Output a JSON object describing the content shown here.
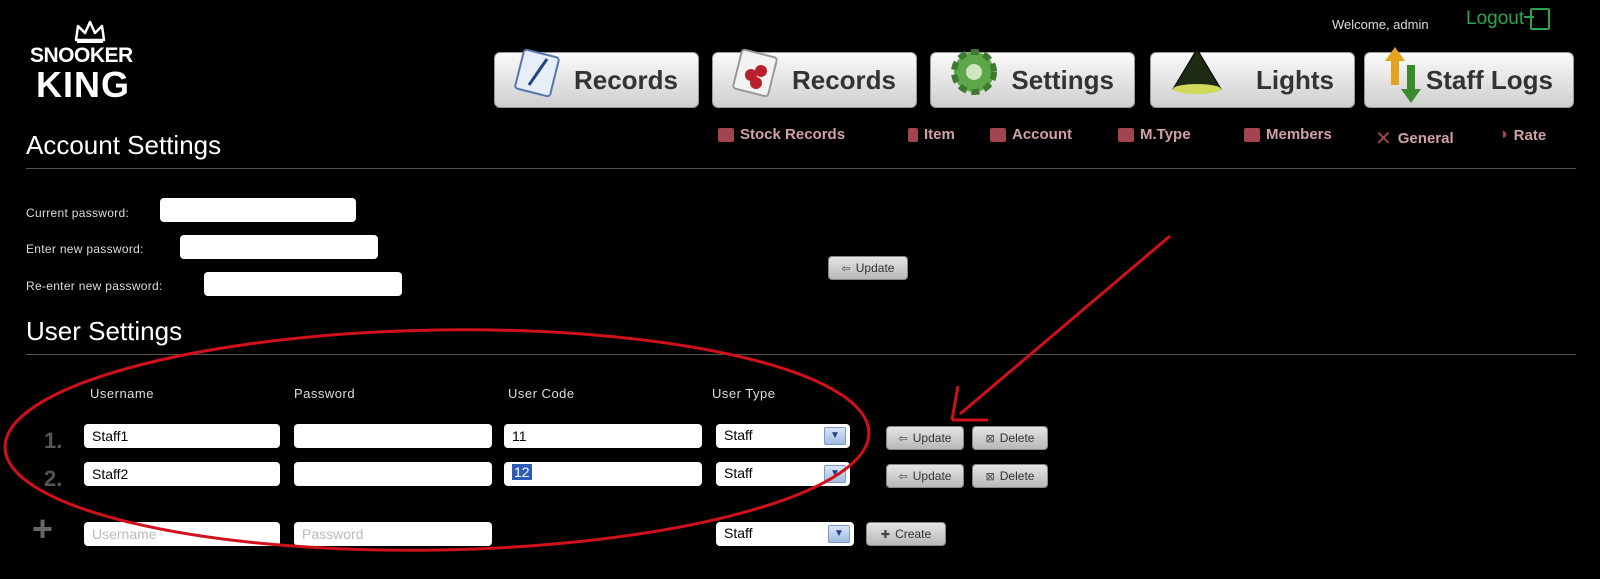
{
  "header": {
    "logo_line1": "SNOOKER",
    "logo_line2": "KING",
    "welcome": "Welcome, admin",
    "logout": "Logout"
  },
  "tabs": [
    {
      "label": "Records",
      "icon": "notepad-icon"
    },
    {
      "label": "Records",
      "icon": "balls-icon"
    },
    {
      "label": "Settings",
      "icon": "gear-icon"
    },
    {
      "label": "Lights",
      "icon": "lamp-icon"
    },
    {
      "label": "Staff Logs",
      "icon": "up-down-arrows-icon"
    }
  ],
  "subnav": [
    {
      "label": "Stock Records",
      "icon": "stock-icon"
    },
    {
      "label": "Item",
      "icon": "item-icon"
    },
    {
      "label": "Account",
      "icon": "account-icon"
    },
    {
      "label": "M.Type",
      "icon": "membership-type-icon"
    },
    {
      "label": "Members",
      "icon": "members-icon"
    },
    {
      "label": "General",
      "icon": "tools-icon"
    },
    {
      "label": "Rate",
      "icon": "rate-icon"
    }
  ],
  "account_settings": {
    "title": "Account Settings",
    "current_password_label": "Current password:",
    "new_password_label": "Enter new password:",
    "reenter_password_label": "Re-enter new password:",
    "update_label": "Update"
  },
  "user_settings": {
    "title": "User Settings",
    "columns": [
      "Username",
      "Password",
      "User Code",
      "User Type"
    ],
    "rows": [
      {
        "num": "1.",
        "username": "Staff1",
        "password": "",
        "user_code": "11",
        "user_type": "Staff"
      },
      {
        "num": "2.",
        "username": "Staff2",
        "password": "",
        "user_code": "12",
        "user_type": "Staff"
      }
    ],
    "row_update_label": "Update",
    "row_delete_label": "Delete",
    "new_row": {
      "username_placeholder": "Username",
      "password_placeholder": "Password",
      "user_type": "Staff",
      "create_label": "Create"
    }
  },
  "annotation_color": "#d0101a"
}
